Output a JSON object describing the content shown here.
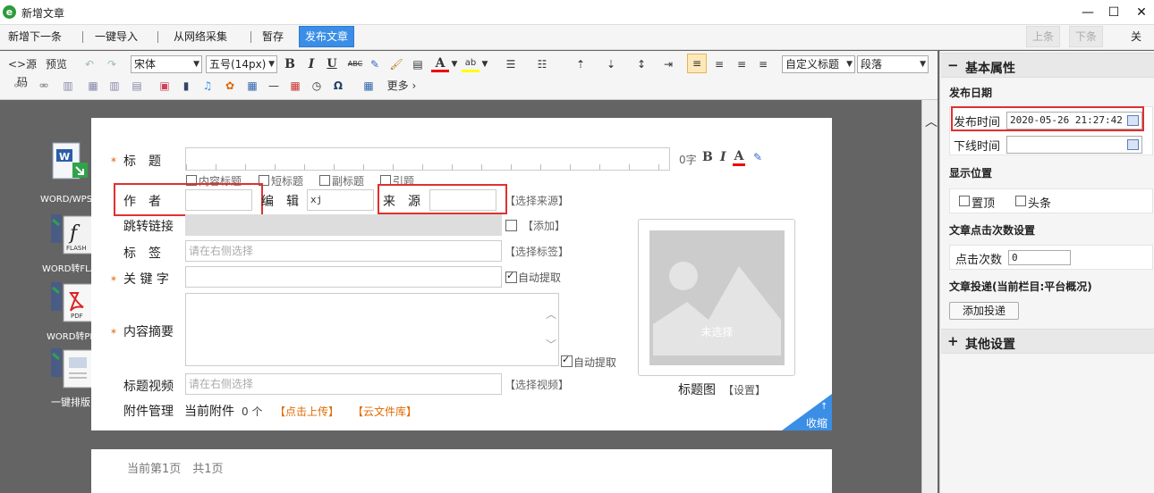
{
  "window": {
    "title": "新增文章",
    "logo": "e",
    "min": "—",
    "max": "☐",
    "close": "✕"
  },
  "toolbar": {
    "new_next": "新增下一条",
    "import": "一键导入",
    "collect": "从网络采集",
    "draft": "暂存",
    "publish": "发布文章",
    "prev": "上条",
    "next": "下条",
    "close": "关闭"
  },
  "editor": {
    "source": "源码",
    "preview": "预览",
    "font": "宋体",
    "size": "五号(14px)",
    "bold": "B",
    "italic": "I",
    "underline": "U",
    "strike": "ABC",
    "custom_heading": "自定义标题",
    "paragraph": "段落",
    "more": "更多",
    "omega": "Ω"
  },
  "left_tools": [
    {
      "label": "WORD/WPS导"
    },
    {
      "label": "WORD转FLA"
    },
    {
      "label": "WORD转PD"
    },
    {
      "label": "一键排版"
    }
  ],
  "form": {
    "title_label": "标　题",
    "char_count": "0字",
    "title_opts": [
      "内容标题",
      "短标题",
      "副标题",
      "引题"
    ],
    "author_label": "作　者",
    "editor_label": "编　辑",
    "editor_value": "xj",
    "source_label": "来　源",
    "choose_source": "【选择来源】",
    "jump_label": "跳转链接",
    "add": "【添加】",
    "tags_label": "标　签",
    "tags_placeholder": "请在右侧选择",
    "choose_tags": "【选择标签】",
    "keywords_label": "关 键 字",
    "auto_extract": "自动提取",
    "summary_label": "内容摘要",
    "auto_extract2": "自动提取",
    "video_label": "标题视频",
    "video_placeholder": "请在右侧选择",
    "choose_video": "【选择视频】",
    "attach_label": "附件管理",
    "current_attach": "当前附件",
    "attach_count": "0 个",
    "upload": "【点击上传】",
    "cloud": "【云文件库】",
    "thumb_empty": "未选择",
    "thumb_label": "标题图",
    "thumb_set": "【设置】",
    "collapse": "收缩",
    "page_info": "当前第1页　共1页"
  },
  "panel": {
    "basic": "基本属性",
    "publish_date": "发布日期",
    "publish_time_label": "发布时间",
    "publish_time": "2020-05-26 21:27:42",
    "offline_label": "下线时间",
    "position": "显示位置",
    "top": "置顶",
    "headline": "头条",
    "clicks_section": "文章点击次数设置",
    "clicks_label": "点击次数",
    "clicks_value": "0",
    "delivery": "文章投递(当前栏目:平台概况)",
    "add_delivery": "添加投递",
    "other": "其他设置"
  },
  "colors": {
    "accent": "#3a8ee6",
    "highlight": "#e03030",
    "link": "#e06b00",
    "canvas": "#646464"
  }
}
